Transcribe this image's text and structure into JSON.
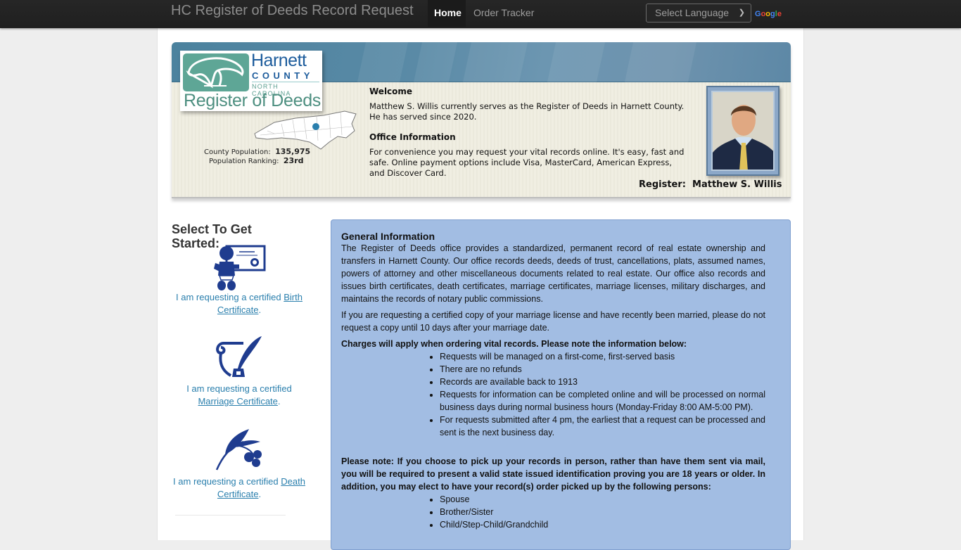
{
  "navbar": {
    "brand": "HC Register of Deeds Record Request",
    "items": [
      {
        "label": "Home",
        "active": true
      },
      {
        "label": "Order Tracker",
        "active": false
      }
    ],
    "language_select": {
      "selected": "Select Language"
    },
    "google_letters": [
      "G",
      "o",
      "o",
      "g",
      "l",
      "e"
    ]
  },
  "banner": {
    "logo": {
      "line1": "Harnett",
      "line2": "COUNTY",
      "line3": "NORTH CAROLINA",
      "line4": "Register of Deeds"
    },
    "population_label": "County Population:",
    "population_value": "135,975",
    "ranking_label": "Population Ranking:",
    "ranking_value": "23rd",
    "welcome_title": "Welcome",
    "welcome_text": "Matthew S. Willis currently serves as the Register of Deeds in Harnett County. He has served since 2020.",
    "office_title": "Office Information",
    "office_text": "For convenience you may request your vital records online.  It's easy, fast and safe.  Online payment options include Visa, MasterCard, American Express, and Discover Card.",
    "register_label": "Register:  Matthew S. Willis"
  },
  "left": {
    "heading": "Select To Get Started:",
    "options": [
      {
        "prefix": "I am requesting a certified ",
        "link": "Birth Certificate",
        "suffix": ".",
        "icon": "baby-certificate-icon"
      },
      {
        "prefix": "I am requesting a certified ",
        "link": "Marriage Certificate",
        "suffix": ".",
        "icon": "scroll-quill-icon"
      },
      {
        "prefix": "I am requesting a certified ",
        "link": "Death Certificate",
        "suffix": ".",
        "icon": "olive-branch-icon"
      }
    ]
  },
  "info": {
    "title": "General Information",
    "para1": "The Register of Deeds office provides a standardized, permanent record of real estate ownership and transfers in Harnett County. Our office records deeds, deeds of trust, cancellations, plats, assumed names, powers of attorney and other miscellaneous documents related to real estate. Our office also records and issues birth certificates, death certificates, marriage certificates, marriage licenses, military discharges, and maintains the records of notary public commissions.",
    "para2": "If you are requesting a certified copy of your marriage license and have recently been married, please do not request a copy until 10 days after your marriage date.",
    "charges_heading": "Charges will apply when ordering vital records. Please note the information below:",
    "charges_items": [
      "Requests will be managed on a first-come, first-served basis",
      "There are no refunds",
      "Records are available back to 1913",
      "Requests for information can be completed online and will be processed on normal business days during normal business hours (Monday-Friday 8:00 AM-5:00 PM).",
      "For requests submitted after 4 pm, the earliest that a request can be processed and sent is the next business day."
    ],
    "note": "Please note: If you choose to pick up your records in person, rather than have them sent via mail, you will be required to present a valid state issued identification proving you are 18 years or older. In addition, you may elect to have your record(s) order picked up by the following persons:",
    "persons": [
      "Spouse",
      "Brother/Sister",
      "Child/Step-Child/Grandchild"
    ]
  }
}
